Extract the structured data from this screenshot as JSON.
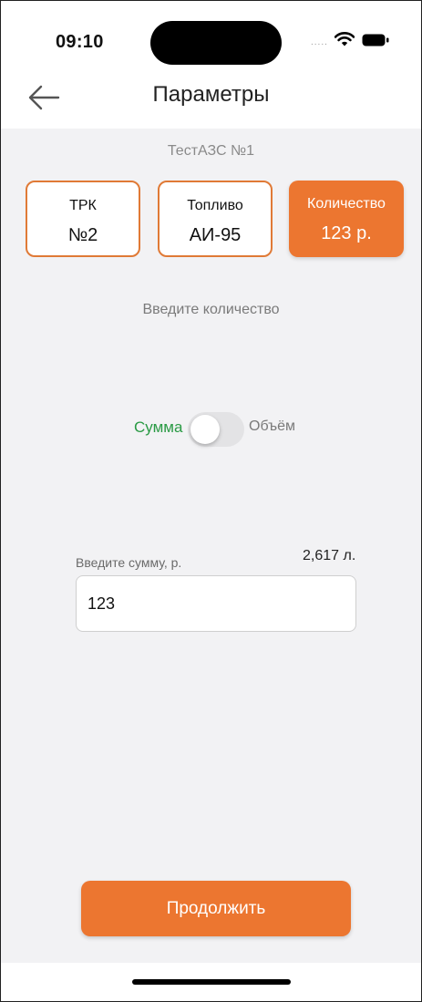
{
  "status_bar": {
    "time": "09:10",
    "signal": "....."
  },
  "nav": {
    "title": "Параметры"
  },
  "station": "ТестАЗС №1",
  "cards": [
    {
      "label": "ТРК",
      "value": "№2"
    },
    {
      "label": "Топливо",
      "value": "АИ-95"
    },
    {
      "label": "Количество",
      "value": "123 р."
    }
  ],
  "hint": "Введите количество",
  "toggle": {
    "left_label": "Сумма",
    "right_label": "Объём",
    "selected": "Сумма"
  },
  "amount": {
    "label": "Введите сумму, р.",
    "value": "123",
    "converted": "2,617 л."
  },
  "actions": {
    "continue_label": "Продолжить"
  },
  "colors": {
    "accent": "#ec7630",
    "accent_border": "#e07a36",
    "toggle_active_text": "#2a9a44",
    "background": "#f2f2f4"
  }
}
